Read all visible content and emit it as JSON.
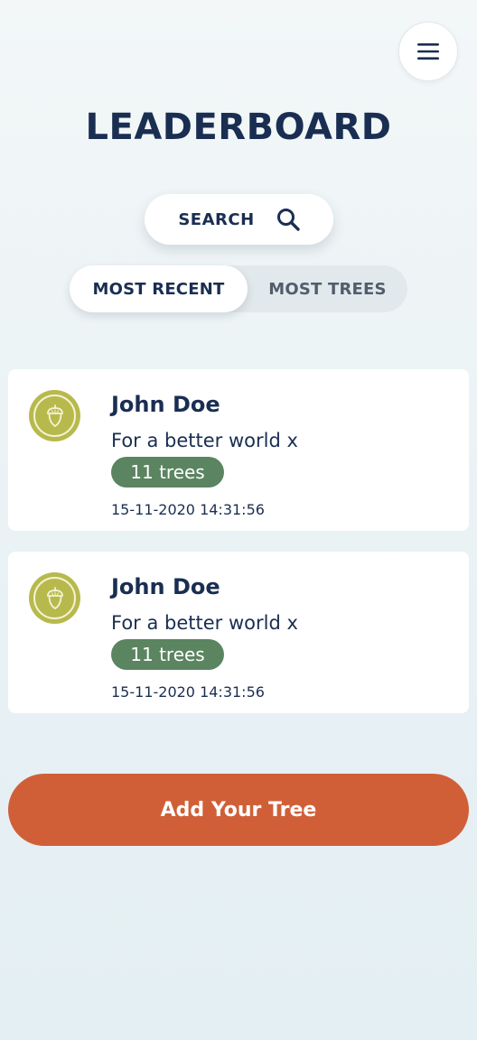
{
  "header": {
    "title": "LEADERBOARD",
    "menu_icon": "hamburger-icon"
  },
  "search": {
    "label": "SEARCH",
    "icon": "search-icon"
  },
  "tabs": [
    {
      "label": "MOST RECENT",
      "active": true
    },
    {
      "label": "MOST TREES",
      "active": false
    }
  ],
  "entries": [
    {
      "name": "John Doe",
      "message": "For a better world x",
      "trees": "11 trees",
      "timestamp": "15-11-2020 14:31:56",
      "avatar_icon": "acorn-icon"
    },
    {
      "name": "John Doe",
      "message": "For a better world x",
      "trees": "11 trees",
      "timestamp": "15-11-2020 14:31:56",
      "avatar_icon": "acorn-icon"
    }
  ],
  "cta": {
    "label": "Add Your Tree"
  },
  "colors": {
    "navy": "#1a2e52",
    "badge_green": "#5b8460",
    "avatar_olive": "#b8b94c",
    "cta_orange": "#d05f38"
  }
}
